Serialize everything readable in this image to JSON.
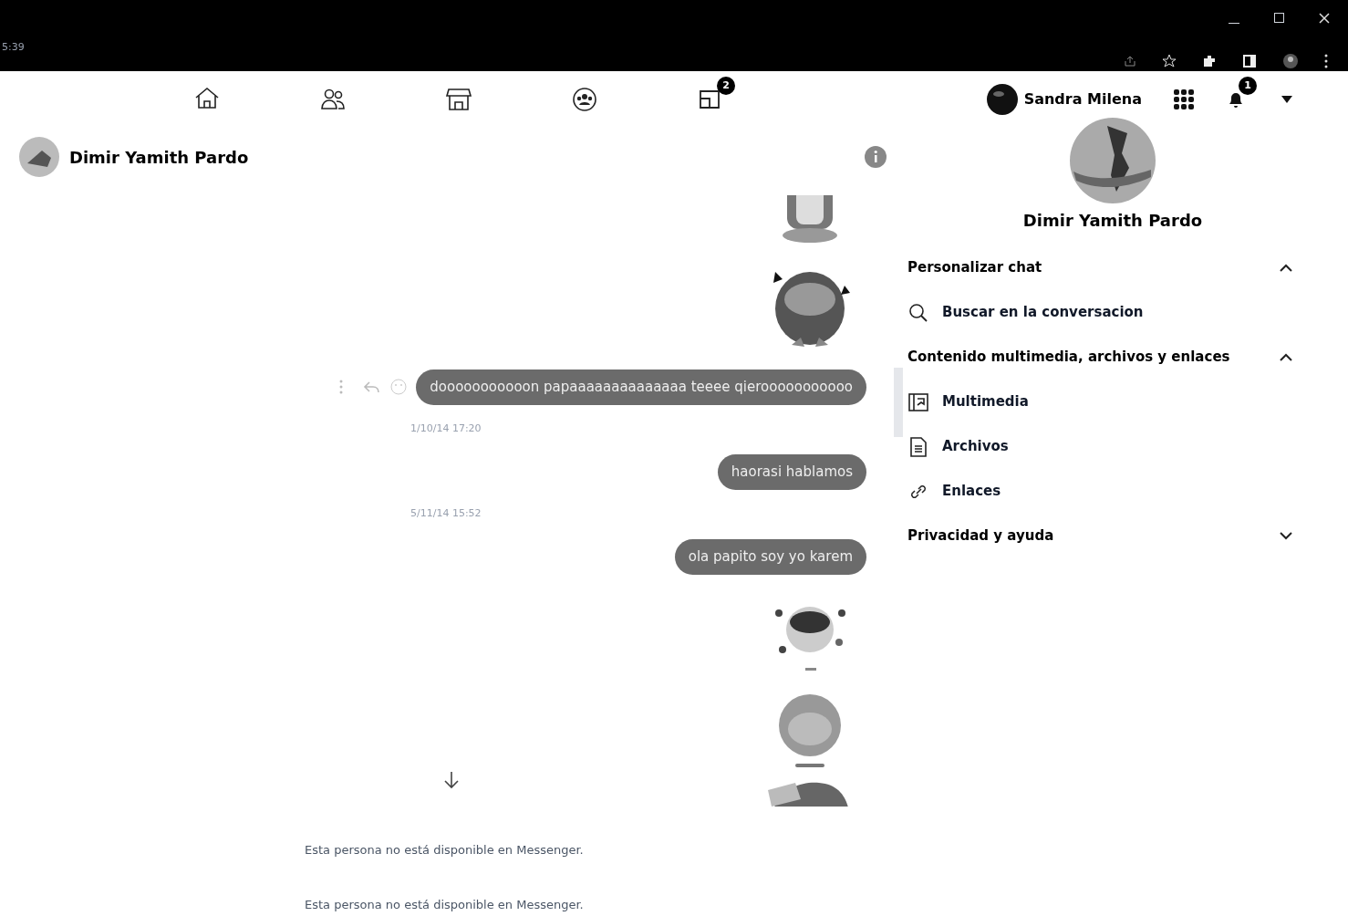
{
  "browser": {
    "clock": "5:39"
  },
  "nav": {
    "icons": [
      {
        "kind": "home"
      },
      {
        "kind": "friends"
      },
      {
        "kind": "market"
      },
      {
        "kind": "groups"
      },
      {
        "kind": "gaming",
        "badge": "2"
      }
    ]
  },
  "account": {
    "name": "Sandra Milena",
    "notification_badge": "1"
  },
  "chat": {
    "contact": "Dimir Yamith Pardo",
    "messages": [
      {
        "kind": "sticker"
      },
      {
        "kind": "sticker"
      },
      {
        "kind": "text",
        "text": "dooooooooooon papaaaaaaaaaaaaaa teeee qierooooooooooo",
        "actions": true
      },
      {
        "kind": "timestamp",
        "text": "1/10/14 17:20"
      },
      {
        "kind": "text",
        "text": "haorasi hablamos"
      },
      {
        "kind": "timestamp",
        "text": "5/11/14 15:52"
      },
      {
        "kind": "text",
        "text": "ola papito soy yo karem"
      },
      {
        "kind": "sticker"
      },
      {
        "kind": "sticker"
      },
      {
        "kind": "sticker"
      }
    ],
    "notices": [
      "Esta persona no está disponible en Messenger.",
      "Esta persona no está disponible en Messenger."
    ]
  },
  "details": {
    "name": "Dimir Yamith Pardo",
    "sections": [
      {
        "title": "Personalizar chat",
        "expanded": true,
        "items": [
          {
            "kind": "search",
            "label": "Buscar en la conversacion"
          }
        ]
      },
      {
        "title": "Contenido multimedia, archivos y enlaces",
        "expanded": true,
        "items": [
          {
            "kind": "media",
            "label": "Multimedia"
          },
          {
            "kind": "file",
            "label": "Archivos"
          },
          {
            "kind": "link",
            "label": "Enlaces"
          }
        ]
      },
      {
        "title": "Privacidad y ayuda",
        "expanded": false
      }
    ]
  }
}
